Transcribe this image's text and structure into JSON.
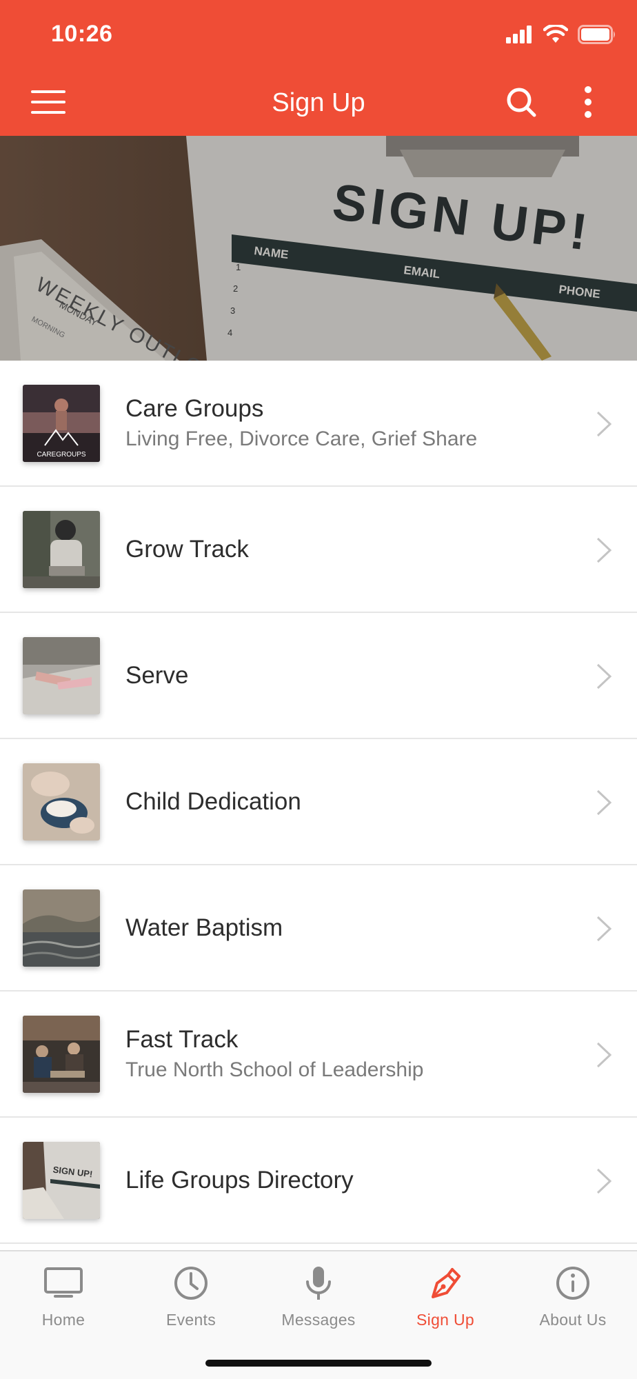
{
  "status_bar": {
    "time": "10:26"
  },
  "navbar": {
    "title": "Sign Up"
  },
  "hero": {
    "headline": "SIGN UP!",
    "columns": [
      "NAME",
      "EMAIL",
      "PHONE"
    ],
    "row_numbers": [
      "1",
      "2",
      "3",
      "4"
    ],
    "notebook_title": "WEEKLY OUTLO",
    "notebook_day": "MONDAY",
    "notebook_sub": "MORNING"
  },
  "list": [
    {
      "title": "Care Groups",
      "subtitle": "Living Free, Divorce Care, Grief Share",
      "thumb_text": "CAREGROUPS"
    },
    {
      "title": "Grow Track",
      "subtitle": ""
    },
    {
      "title": "Serve",
      "subtitle": ""
    },
    {
      "title": "Child Dedication",
      "subtitle": ""
    },
    {
      "title": "Water Baptism",
      "subtitle": ""
    },
    {
      "title": "Fast Track",
      "subtitle": "True North School of Leadership"
    },
    {
      "title": "Life Groups Directory",
      "subtitle": "",
      "thumb_text": "SIGN UP!"
    }
  ],
  "tabbar": {
    "tabs": [
      {
        "label": "Home",
        "icon": "monitor-icon",
        "active": false
      },
      {
        "label": "Events",
        "icon": "clock-icon",
        "active": false
      },
      {
        "label": "Messages",
        "icon": "microphone-icon",
        "active": false
      },
      {
        "label": "Sign Up",
        "icon": "pen-nib-icon",
        "active": true
      },
      {
        "label": "About Us",
        "icon": "info-icon",
        "active": false
      }
    ]
  },
  "colors": {
    "accent": "#ef4d36",
    "inactive_tab": "#8b8b8b",
    "divider": "#e6e6e6"
  }
}
